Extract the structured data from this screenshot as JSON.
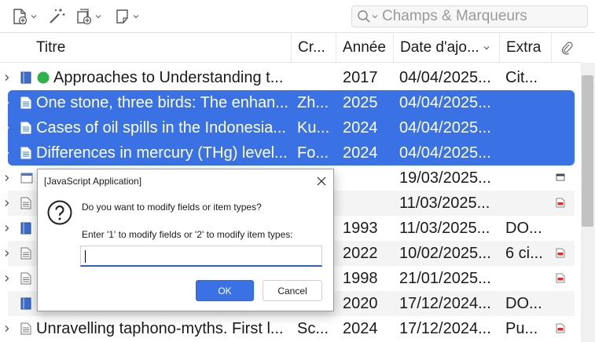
{
  "toolbar": {
    "search_placeholder": "Champs & Marqueurs",
    "icons": [
      "new-item-icon",
      "magic-wand-icon",
      "add-attachment-icon",
      "new-note-icon",
      "search-icon"
    ]
  },
  "columns": [
    "Titre",
    "Cr...",
    "Année",
    "Date d'ajo...",
    "Extra"
  ],
  "rows": [
    {
      "title": "Approaches to Understanding t...",
      "creator": "",
      "year": "2017",
      "date": "04/04/2025...",
      "extra": "Cit..."
    },
    {
      "title": "One stone, three birds: The enhan...",
      "creator": "Zh...",
      "year": "2025",
      "date": "04/04/2025...",
      "extra": ""
    },
    {
      "title": "Cases of oil spills in the Indonesia...",
      "creator": "Ku...",
      "year": "2024",
      "date": "04/04/2025...",
      "extra": ""
    },
    {
      "title": "Differences in mercury (THg) level...",
      "creator": "Fo...",
      "year": "2024",
      "date": "04/04/2025...",
      "extra": ""
    },
    {
      "title": "",
      "creator": "",
      "year": "",
      "date": "19/03/2025...",
      "extra": ""
    },
    {
      "title": "",
      "creator": "",
      "year": "",
      "date": "11/03/2025...",
      "extra": ""
    },
    {
      "title": "",
      "creator": "",
      "year": "1993",
      "date": "11/03/2025...",
      "extra": "DO..."
    },
    {
      "title": "",
      "creator": "",
      "year": "2022",
      "date": "10/02/2025...",
      "extra": "6 ci..."
    },
    {
      "title": "",
      "creator": "",
      "year": "1998",
      "date": "21/01/2025...",
      "extra": ""
    },
    {
      "title": "",
      "creator": "",
      "year": "2020",
      "date": "17/12/2024...",
      "extra": "DO..."
    },
    {
      "title": "Unravelling taphono-myths. First l...",
      "creator": "Sc...",
      "year": "2024",
      "date": "17/12/2024...",
      "extra": "Pu..."
    }
  ],
  "dialog": {
    "title": "[JavaScript Application]",
    "message": "Do you want to modify fields or item types?",
    "prompt": "Enter '1' to modify fields or '2' to modify item types:",
    "input_value": "",
    "ok_label": "OK",
    "cancel_label": "Cancel"
  },
  "colors": {
    "selection": "#3a72e6",
    "tag_green": "#2fb24a",
    "pdf_red": "#d43030"
  }
}
